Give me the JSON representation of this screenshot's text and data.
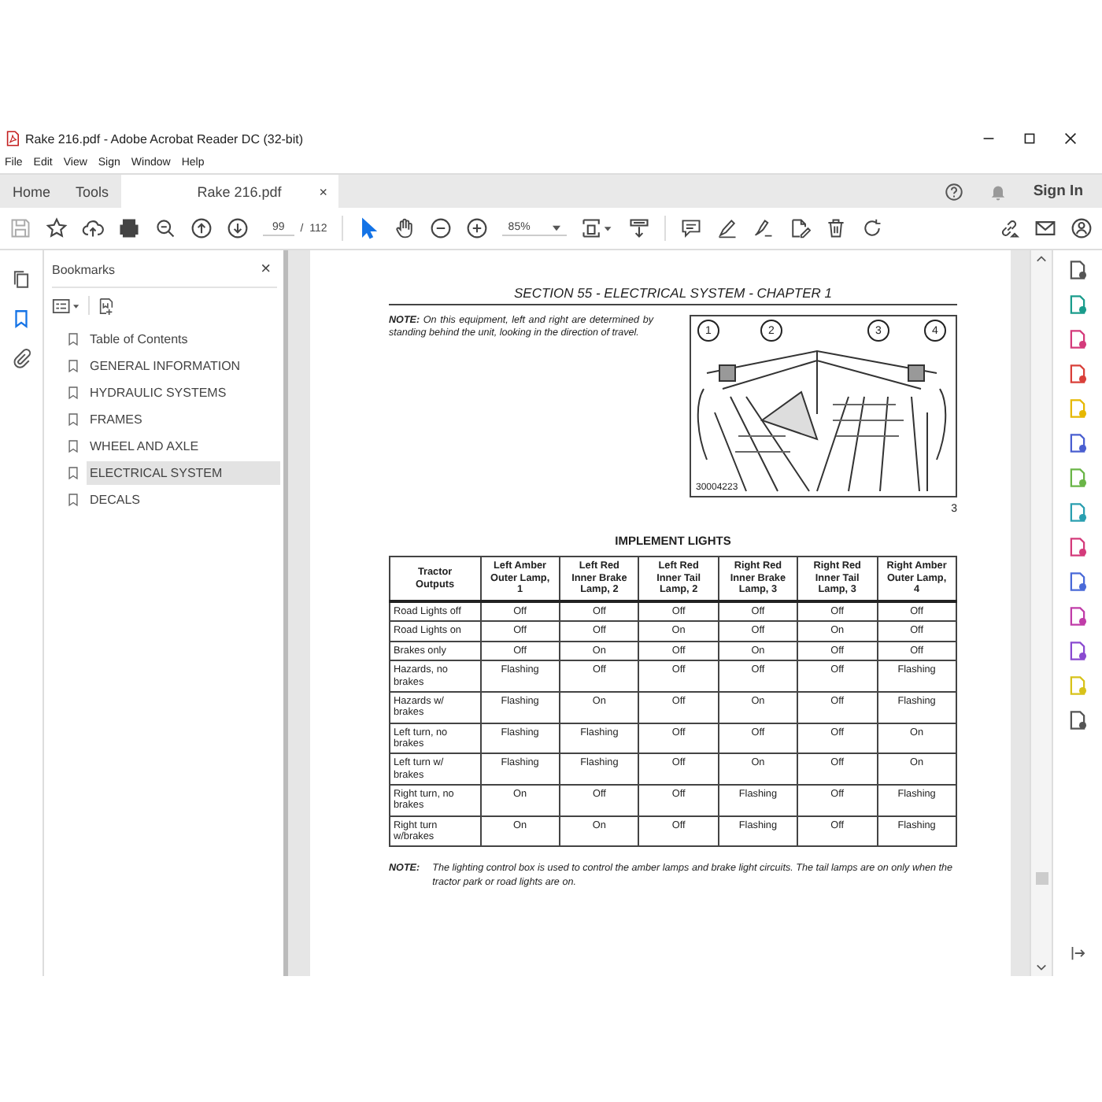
{
  "window": {
    "title": "Rake 216.pdf - Adobe Acrobat Reader DC (32-bit)"
  },
  "menu": [
    "File",
    "Edit",
    "View",
    "Sign",
    "Window",
    "Help"
  ],
  "tabs": [
    {
      "label": "Home",
      "selected": false,
      "closable": false
    },
    {
      "label": "Tools",
      "selected": false,
      "closable": false
    },
    {
      "label": "Rake 216.pdf",
      "selected": true,
      "closable": true
    }
  ],
  "close_glyph": "×",
  "sign_in": "Sign In",
  "toolbar": {
    "save_disabled": true,
    "page_current": "99",
    "page_total": "/  112",
    "zoom": "85%",
    "tools": [
      {
        "kind": "select",
        "selected": true
      },
      {
        "kind": "hand",
        "selected": false
      }
    ]
  },
  "left_nav": [
    {
      "kind": "pages",
      "selected": false
    },
    {
      "kind": "bookmarks",
      "selected": true
    },
    {
      "kind": "attachments",
      "selected": false
    }
  ],
  "bookmarks": {
    "title": "Bookmarks",
    "close": "×",
    "items": [
      {
        "label": "Table of Contents",
        "selected": false
      },
      {
        "label": "GENERAL INFORMATION",
        "selected": false
      },
      {
        "label": "HYDRAULIC SYSTEMS",
        "selected": false
      },
      {
        "label": "FRAMES",
        "selected": false
      },
      {
        "label": "WHEEL AND AXLE",
        "selected": false
      },
      {
        "label": "ELECTRICAL SYSTEM",
        "selected": true
      },
      {
        "label": "DECALS",
        "selected": false
      }
    ]
  },
  "document": {
    "section_title": "SECTION 55 - ELECTRICAL SYSTEM - CHAPTER 1",
    "note": "**NOTE:** On this equipment, left and right are determined by standing behind the unit, looking in the direction of travel.",
    "figure": {
      "callouts": [
        "1",
        "2",
        "3",
        "4"
      ],
      "code": "30004223",
      "number": "3"
    },
    "table_title": "IMPLEMENT LIGHTS",
    "table": {
      "columns": [
        "Tractor Outputs",
        "Left Amber Outer Lamp, 1",
        "Left Red Inner Brake Lamp, 2",
        "Left Red Inner Tail Lamp, 2",
        "Right Red Inner Brake Lamp, 3",
        "Right Red Inner Tail Lamp, 3",
        "Right Amber Outer Lamp, 4"
      ],
      "rows": [
        [
          "Road Lights off",
          "Off",
          "Off",
          "Off",
          "Off",
          "Off",
          "Off"
        ],
        [
          "Road Lights on",
          "Off",
          "Off",
          "On",
          "Off",
          "On",
          "Off"
        ],
        [
          "Brakes only",
          "Off",
          "On",
          "Off",
          "On",
          "Off",
          "Off"
        ],
        [
          "Hazards, no brakes",
          "Flashing",
          "Off",
          "Off",
          "Off",
          "Off",
          "Flashing"
        ],
        [
          "Hazards w/ brakes",
          "Flashing",
          "On",
          "Off",
          "On",
          "Off",
          "Flashing"
        ],
        [
          "Left turn, no brakes",
          "Flashing",
          "Flashing",
          "Off",
          "Off",
          "Off",
          "On"
        ],
        [
          "Left turn w/ brakes",
          "Flashing",
          "Flashing",
          "Off",
          "On",
          "Off",
          "On"
        ],
        [
          "Right turn, no brakes",
          "On",
          "Off",
          "Off",
          "Flashing",
          "Off",
          "Flashing"
        ],
        [
          "Right turn w/brakes",
          "On",
          "On",
          "Off",
          "Flashing",
          "Off",
          "Flashing"
        ]
      ]
    },
    "bottom_note": {
      "label": "NOTE:",
      "text": "The lighting control box is used to control the amber lamps and brake light circuits. The tail lamps are on only when the tractor park or road lights are on."
    }
  }
}
